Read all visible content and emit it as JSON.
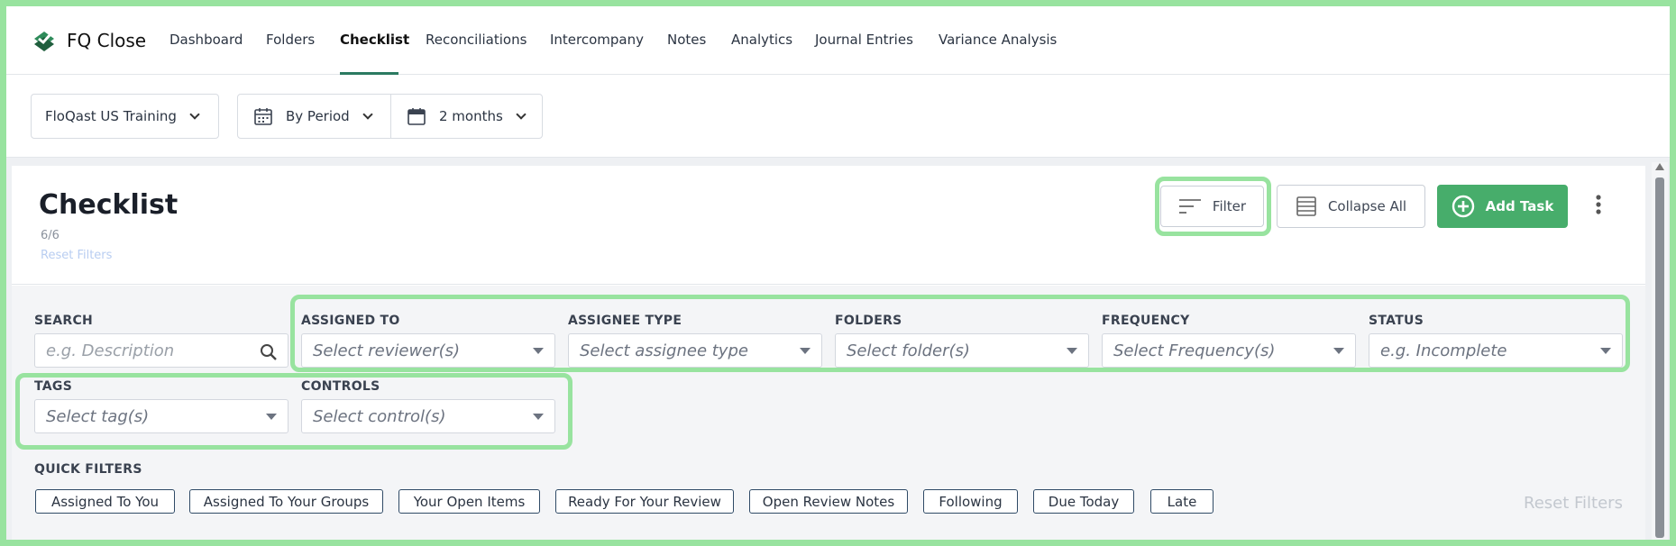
{
  "brand": {
    "name": "FQ Close",
    "accent": "#2b7a61",
    "icon": "floqast-logo-icon"
  },
  "nav": {
    "items": [
      {
        "label": "Dashboard"
      },
      {
        "label": "Folders"
      },
      {
        "label": "Checklist",
        "active": true
      },
      {
        "label": "Reconciliations"
      },
      {
        "label": "Intercompany"
      },
      {
        "label": "Notes"
      },
      {
        "label": "Analytics"
      },
      {
        "label": "Journal Entries"
      },
      {
        "label": "Variance Analysis"
      }
    ]
  },
  "subbar": {
    "entity": "FloQast US Training",
    "view": "By Period",
    "range": "2 months"
  },
  "checklist": {
    "title": "Checklist",
    "count": "6/6",
    "reset_link": "Reset Filters",
    "buttons": {
      "filter": "Filter",
      "collapse": "Collapse All",
      "add": "Add Task"
    },
    "add_color": "#47ad6b"
  },
  "filters": {
    "search": {
      "label": "SEARCH",
      "placeholder": "e.g. Description"
    },
    "assigned_to": {
      "label": "ASSIGNED TO",
      "placeholder": "Select reviewer(s)"
    },
    "assignee_type": {
      "label": "ASSIGNEE TYPE",
      "placeholder": "Select assignee type"
    },
    "folders": {
      "label": "FOLDERS",
      "placeholder": "Select folder(s)"
    },
    "frequency": {
      "label": "FREQUENCY",
      "placeholder": "Select Frequency(s)"
    },
    "status": {
      "label": "STATUS",
      "placeholder": "e.g. Incomplete"
    },
    "tags": {
      "label": "TAGS",
      "placeholder": "Select tag(s)"
    },
    "controls": {
      "label": "CONTROLS",
      "placeholder": "Select control(s)"
    }
  },
  "quick_filters": {
    "label": "QUICK FILTERS",
    "chips": [
      "Assigned To You",
      "Assigned To Your Groups",
      "Your Open Items",
      "Ready For Your Review",
      "Open Review Notes",
      "Following",
      "Due Today",
      "Late"
    ],
    "reset": "Reset Filters"
  },
  "highlight_color": "#98e39f"
}
